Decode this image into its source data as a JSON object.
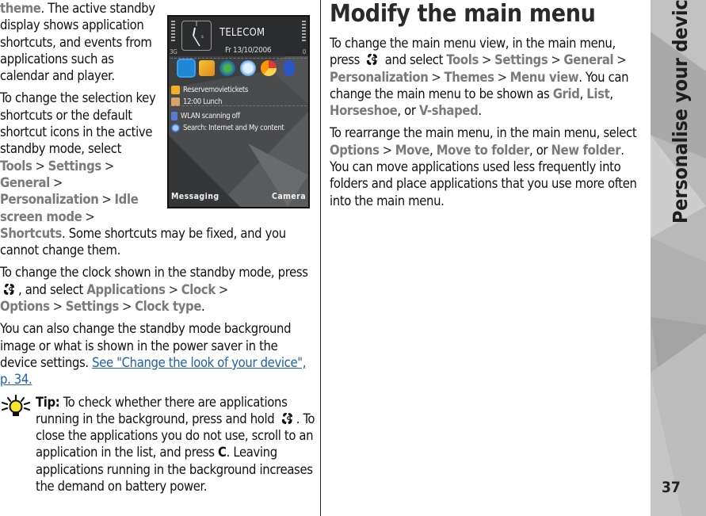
{
  "left_column": {
    "intro": {
      "menu_theme": "theme",
      "text": ".  The active standby display shows application shortcuts, and events from applications such as calendar and player."
    },
    "phone_screenshot": {
      "operator": "TELECOM",
      "date": "Fr 13/10/2006",
      "network": "3G",
      "battery_label": "0",
      "shortcut_icons": [
        "contacts-icon",
        "messaging-icon",
        "web-icon",
        "clock-icon",
        "media-icon",
        "bluetooth-icon"
      ],
      "events": [
        {
          "icon": "calendar-note-icon",
          "text": "Reservemovietickets"
        },
        {
          "icon": "meeting-icon",
          "text": "12:00 Lunch"
        },
        {
          "icon": "wlan-icon",
          "text": "WLAN scanning off"
        },
        {
          "icon": "search-icon",
          "text": "Search: Internet and My content"
        }
      ],
      "softkey_left": "Messaging",
      "softkey_right": "Camera"
    },
    "para_shortcuts": {
      "before": "To change the selection key shortcuts or the default shortcut icons in the active standby mode, select",
      "path": [
        "Tools",
        "Settings",
        "General",
        "Personalization",
        "Idle screen mode",
        "Shortcuts"
      ],
      "after": ". Some shortcuts may be fixed, and you cannot change them."
    },
    "para_clock": {
      "before": "To change the clock shown in the standby mode, press",
      "middle": ", and select",
      "path": [
        "Applications",
        "Clock",
        "Options",
        "Settings",
        "Clock type"
      ],
      "after": "."
    },
    "para_background": {
      "text": "You can also change the standby mode background image or what is shown in the power saver in the device settings.",
      "link": "See \"Change the look of your device\", p. 34."
    },
    "tip": {
      "label": "Tip:",
      "text1": "To check whether there are applications running in the background, press and hold",
      "text2": ". To close the applications you do not use, scroll to an application in the list, and press",
      "key": "C",
      "text3": ". Leaving applications running in the background increases the demand on battery power."
    }
  },
  "right_column": {
    "heading": "Modify the main menu",
    "para_view": {
      "before": "To change the main menu view, in the main menu, press",
      "middle": "and select",
      "path": [
        "Tools",
        "Settings",
        "General",
        "Personalization",
        "Themes",
        "Menu view"
      ],
      "after1": ". You can change the main menu to be shown as",
      "options": [
        "Grid",
        "List",
        "Horseshoe",
        "V-shaped"
      ],
      "after2": "."
    },
    "para_rearrange": {
      "before": "To rearrange the main menu, in the main menu, select",
      "path": [
        "Options",
        "Move"
      ],
      "opt2": "Move to folder",
      "opt3": "New folder",
      "after": ". You can move applications used less frequently into folders and place applications that you use more often into the main menu."
    }
  },
  "sidebar": {
    "chapter_title": "Personalise your device",
    "page_number": "37"
  },
  "colors": {
    "menu_path": "#7a7a7a",
    "link": "#1f5fb0",
    "text": "#111111",
    "sidebar_bg": "#b9b9b9"
  }
}
